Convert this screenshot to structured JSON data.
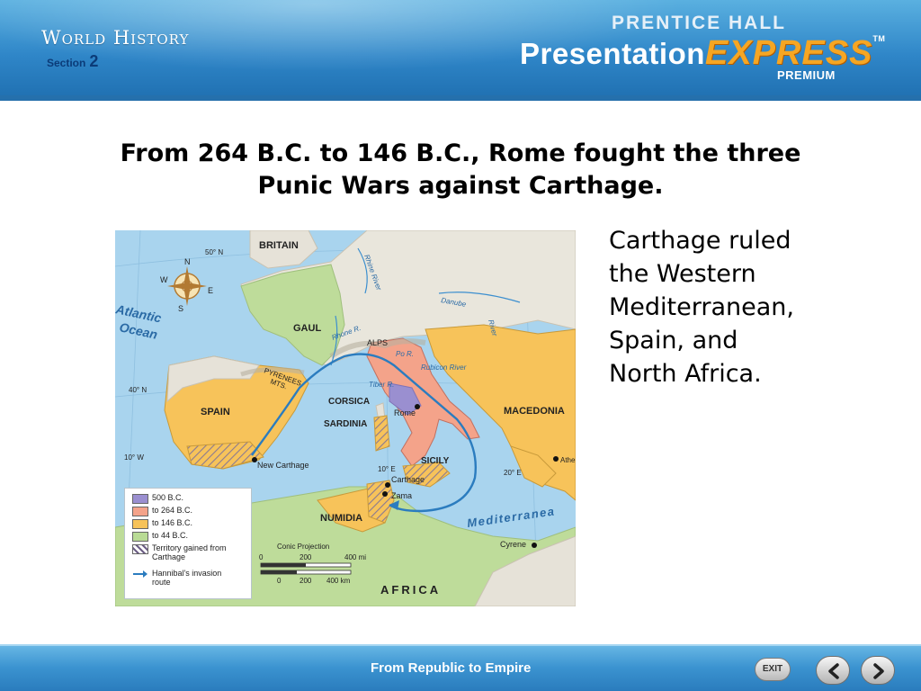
{
  "header": {
    "series_title": "World History",
    "section_label": "Section",
    "section_number": "2",
    "publisher": "PRENTICE HALL",
    "product_prefix": "Presentation",
    "product_suffix": "EXPRESS",
    "trademark": "TM",
    "edition": "PREMIUM"
  },
  "slide": {
    "heading_line1": "From 264 B.C. to 146 B.C., Rome fought the three",
    "heading_line2": "Punic Wars against Carthage.",
    "body_lines": [
      "Carthage ruled",
      "the Western",
      "Mediterranean,",
      "Spain, and",
      "North Africa."
    ]
  },
  "map": {
    "labels": {
      "britain": "BRITAIN",
      "gaul": "GAUL",
      "spain": "SPAIN",
      "corsica": "CORSICA",
      "sardinia": "SARDINIA",
      "sicily": "SICILY",
      "numidia": "NUMIDIA",
      "macedonia": "MACEDONIA",
      "africa": "AFRICA",
      "atlantic": "Atlantic",
      "ocean": "Ocean",
      "mediterranean": "Mediterranea",
      "alps": "ALPS",
      "pyrenees": "PYRENEES",
      "mts": "MTS.",
      "rhone": "Rhone R.",
      "rhine": "Rhine River",
      "danube": "Danube",
      "river": "River",
      "po": "Po R.",
      "rubicon": "Rubicon River",
      "tiber": "Tiber R.",
      "rome": "Rome",
      "new_carthage": "New Carthage",
      "carthage": "Carthage",
      "zama": "Zama",
      "cyrene": "Cyrene",
      "athens": "Athe",
      "lat50": "50° N",
      "lat40": "40° N",
      "lon10w": "10° W",
      "lon10e": "10° E",
      "lon20e": "20° E",
      "compass_n": "N",
      "compass_s": "S",
      "compass_e": "E",
      "compass_w": "W",
      "projection": "Conic Projection",
      "scale_mi": [
        "0",
        "200",
        "400 mi"
      ],
      "scale_km": [
        "0",
        "200",
        "400 km"
      ]
    },
    "legend": [
      {
        "label": "500 B.C.",
        "color": "#9a8fd0"
      },
      {
        "label": "to 264 B.C.",
        "color": "#f4a38a"
      },
      {
        "label": "to 146 B.C.",
        "color": "#f7c35a"
      },
      {
        "label": "to 44 B.C.",
        "color": "#b9db95"
      },
      {
        "label": "Territory gained from Carthage",
        "color": "hatched"
      },
      {
        "label": "Hannibal's invasion route",
        "color": "#2b7cbf"
      }
    ]
  },
  "footer": {
    "title": "From Republic to Empire",
    "exit_label": "EXIT"
  }
}
